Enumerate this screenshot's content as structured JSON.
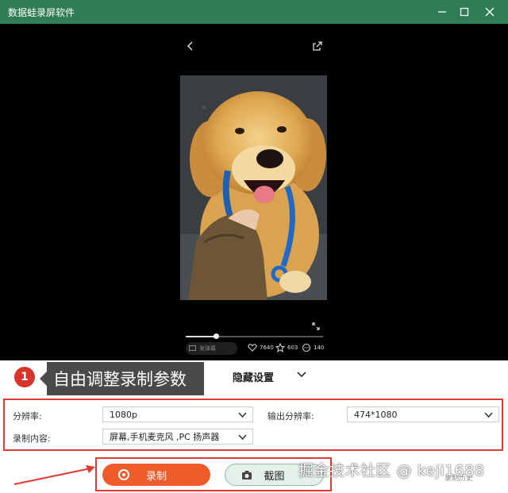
{
  "window": {
    "title": "数据蛙录屏软件",
    "controls": {
      "minimize_icon": "minimize-icon",
      "maximize_icon": "maximize-icon",
      "close_icon": "close-icon"
    }
  },
  "player": {
    "back_icon": "chevron-left-icon",
    "share_icon": "share-icon",
    "progress": 0.22,
    "comment_placeholder": "发弹幕",
    "likes": "7640",
    "favorites": "603",
    "comments": "140"
  },
  "annotation": {
    "step_number": "1",
    "callout": "自由调整录制参数"
  },
  "settings_toggle": {
    "label": "隐藏设置"
  },
  "settings": {
    "resolution_label": "分辨率:",
    "resolution_value": "1080p",
    "output_resolution_label": "输出分辨率:",
    "output_resolution_value": "474*1080",
    "content_label": "录制内容:",
    "content_value": "屏幕,手机麦克风 ,PC 扬声器"
  },
  "actions": {
    "record_label": "录制",
    "screenshot_label": "截图",
    "history_label": "录制历史"
  },
  "watermark": "掘金技术社区 @ keji1688",
  "colors": {
    "titlebar": "#2f7d54",
    "record_button": "#ef5b2a",
    "highlight_border": "#e23a30",
    "callout_bg": "#4a4a4a"
  }
}
